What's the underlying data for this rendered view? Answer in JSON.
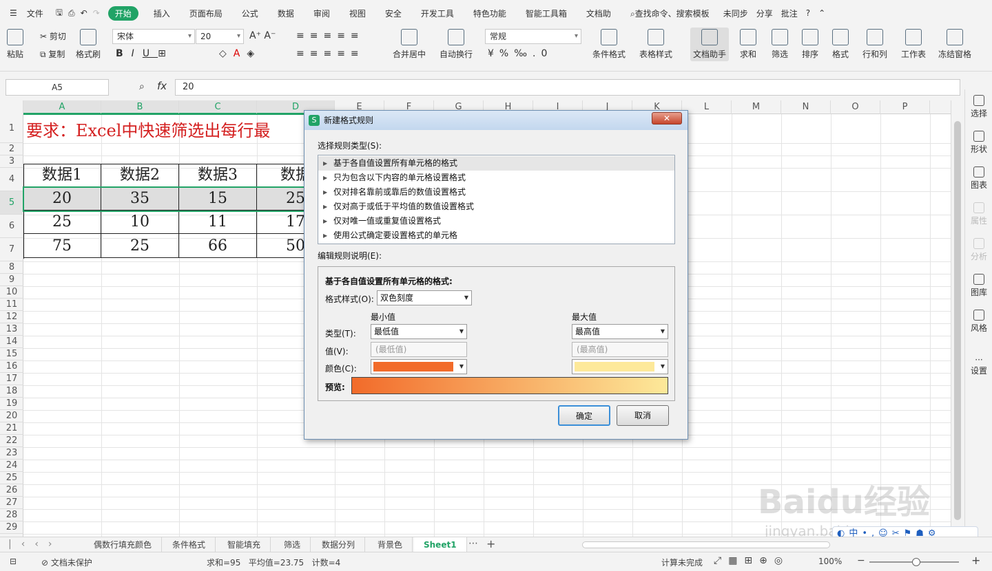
{
  "menubar": {
    "file": "文件",
    "tabs": [
      "开始",
      "插入",
      "页面布局",
      "公式",
      "数据",
      "审阅",
      "视图",
      "安全",
      "开发工具",
      "特色功能",
      "智能工具箱",
      "文档助"
    ],
    "active_tab": "开始",
    "search": "查找命令、搜索模板",
    "sync": "未同步",
    "share": "分享",
    "comment": "批注"
  },
  "ribbon": {
    "paste": "粘贴",
    "cut": "剪切",
    "copy": "复制",
    "format_painter": "格式刷",
    "font_name": "宋体",
    "font_size": "20",
    "merge_center": "合并居中",
    "wrap_text": "自动换行",
    "number_format": "常规",
    "cond_format": "条件格式",
    "table_style": "表格样式",
    "doc_helper": "文档助手",
    "sum": "求和",
    "filter": "筛选",
    "sort": "排序",
    "format": "格式",
    "row_col": "行和列",
    "worksheet": "工作表",
    "freeze": "冻结窗格"
  },
  "formulabar": {
    "namebox": "A5",
    "fx": "fx",
    "value": "20"
  },
  "sheet": {
    "columns": [
      "A",
      "B",
      "C",
      "D",
      "E",
      "F",
      "G",
      "H",
      "I",
      "J",
      "K",
      "L",
      "M",
      "N",
      "O",
      "P"
    ],
    "title": "要求：Excel中快速筛选出每行最",
    "headers": [
      "数据1",
      "数据2",
      "数据3",
      "数据"
    ],
    "rows": [
      [
        "20",
        "35",
        "15",
        "25"
      ],
      [
        "25",
        "10",
        "11",
        "17"
      ],
      [
        "75",
        "25",
        "66",
        "50"
      ]
    ]
  },
  "sheettabs": {
    "tabs": [
      "偶数行填充颜色",
      "条件格式",
      "智能填充",
      "筛选",
      "数据分列",
      "背景色",
      "Sheet1"
    ],
    "active": "Sheet1"
  },
  "status": {
    "protect": "文档未保护",
    "stats": "求和=95   平均值=23.75   计数=4",
    "calc": "计算未完成",
    "zoom": "100%"
  },
  "rightpanel": [
    "选择",
    "形状",
    "图表",
    "属性",
    "分析",
    "图库",
    "风格",
    "设置"
  ],
  "dialog": {
    "title": "新建格式规则",
    "close": "✕",
    "select_type_label": "选择规则类型(S):",
    "rules": [
      "基于各自值设置所有单元格的格式",
      "只为包含以下内容的单元格设置格式",
      "仅对排名靠前或靠后的数值设置格式",
      "仅对高于或低于平均值的数值设置格式",
      "仅对唯一值或重复值设置格式",
      "使用公式确定要设置格式的单元格"
    ],
    "edit_label": "编辑规则说明(E):",
    "edit_heading": "基于各自值设置所有单元格的格式:",
    "style_label": "格式样式(O):",
    "style_value": "双色刻度",
    "min_label": "最小值",
    "max_label": "最大值",
    "type_label": "类型(T):",
    "min_type": "最低值",
    "max_type": "最高值",
    "value_label": "值(V):",
    "min_value": "(最低值)",
    "max_value": "(最高值)",
    "color_label": "颜色(C):",
    "preview_label": "预览:",
    "ok": "确定",
    "cancel": "取消",
    "colors": {
      "min": "#f26b2a",
      "max": "#fde99a"
    }
  },
  "watermark": {
    "brand": "Baidu经验",
    "url": "jingyan.baidu.com"
  }
}
